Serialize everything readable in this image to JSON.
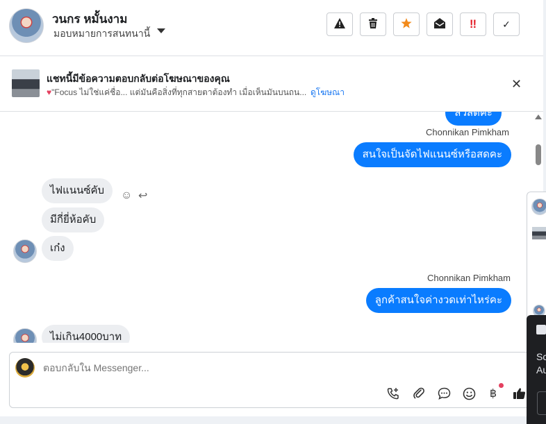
{
  "header": {
    "contact_name": "วนกร หมั้นงาม",
    "assign_label": "มอบหมายการสนทนานี้",
    "toolbar": [
      {
        "name": "report-spam-button",
        "icon": "warning-icon",
        "glyph": "⚠"
      },
      {
        "name": "delete-button",
        "icon": "trash-icon",
        "glyph": "🗑"
      },
      {
        "name": "star-button",
        "icon": "star-icon",
        "glyph": "★"
      },
      {
        "name": "mark-unread-button",
        "icon": "envelope-open-icon",
        "glyph": "✉"
      },
      {
        "name": "mark-urgent-button",
        "icon": "double-exclamation-icon",
        "glyph": "‼"
      },
      {
        "name": "mark-done-button",
        "icon": "check-icon",
        "glyph": "✓"
      }
    ]
  },
  "ad_banner": {
    "title": "แชทนี้มีข้อความตอบกลับต่อโฆษณาของคุณ",
    "snippet": "\"Focus ไม่ใช่แค่ชื่อ... แต่มันคือสิ่งที่ทุกสายตาต้องทำ เมื่อเห็นมันบนถน...",
    "link_label": "ดูโฆษณา"
  },
  "messages": {
    "partial_top": "สวัสดีค่ะ",
    "sender_1": "Chonnikan Pimkham",
    "out_1": "สนใจเป็นจัดไฟแนนซ์หรือสดคะ",
    "in_1": "ไฟแนนซ์คับ",
    "in_2": "มีกี่ยี่ห้อคับ",
    "in_3": "เก๋ง",
    "sender_2": "Chonnikan Pimkham",
    "out_2": "ลูกค้าสนใจค่างวดเท่าไหร่คะ",
    "in_4": "ไม่เกิน4000บาท"
  },
  "composer": {
    "placeholder": "ตอบกลับใน Messenger..."
  },
  "side_window": {
    "line_1": "Sc",
    "line_2": "Au"
  },
  "colors": {
    "outgoing_bubble": "#0a7cff",
    "incoming_bubble": "#eceef1",
    "link": "#1877f2",
    "star": "#f28a1a",
    "urgent": "#e4202a"
  }
}
